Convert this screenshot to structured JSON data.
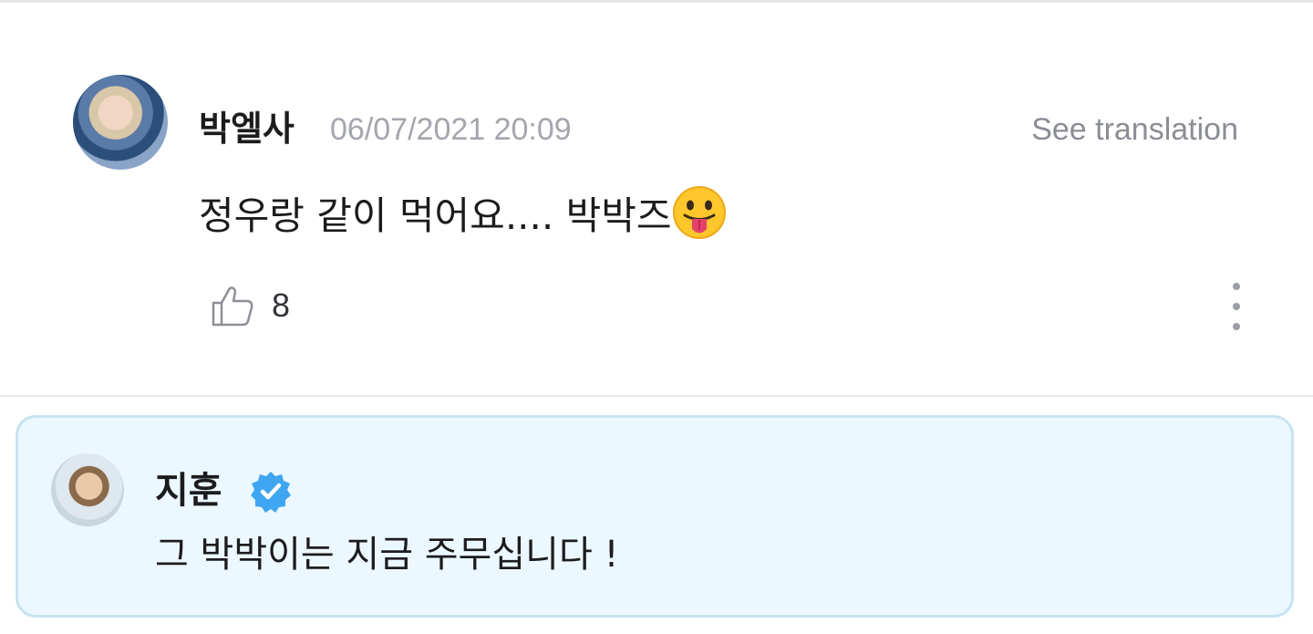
{
  "comment": {
    "author": "박엘사",
    "timestamp": "06/07/2021 20:09",
    "translate_label": "See translation",
    "text": "정우랑 같이 먹어요.... 박박즈",
    "emoji": "face-with-tongue",
    "like_count": "8",
    "icons": [
      "thumbs-up-icon",
      "more-vertical-icon"
    ]
  },
  "reply": {
    "author": "지훈",
    "verified": true,
    "text": "그 박박이는 지금 주무십니다 !",
    "icons": [
      "verified-badge-icon"
    ]
  },
  "colors": {
    "reply_background": "#ecf8ff",
    "reply_border": "#c7e3f0",
    "verified_badge": "#3ea6f2",
    "muted_text": "#a4a6ad"
  }
}
